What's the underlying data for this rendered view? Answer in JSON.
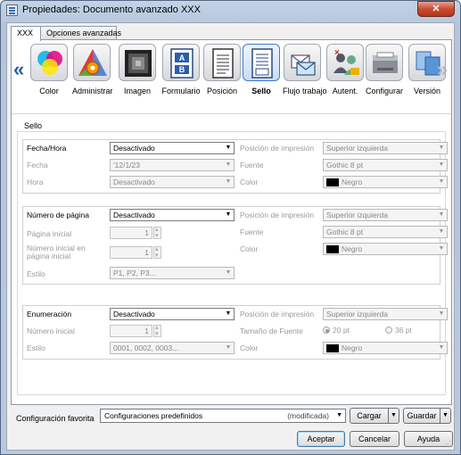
{
  "window": {
    "title": "Propiedades: Documento avanzado XXX",
    "close_glyph": "✕"
  },
  "tabs": [
    {
      "label": "XXX",
      "active": true
    },
    {
      "label": "Opciones avanzadas",
      "active": false
    }
  ],
  "iconbar": {
    "left_arrow": "«",
    "right_arrow": "»",
    "items": [
      {
        "label": "Color",
        "icon": "color-icon"
      },
      {
        "label": "Administrar",
        "icon": "administrar-icon"
      },
      {
        "label": "Imagen",
        "icon": "imagen-icon"
      },
      {
        "label": "Formulario",
        "icon": "formulario-icon"
      },
      {
        "label": "Posición",
        "icon": "posicion-icon"
      },
      {
        "label": "Sello",
        "icon": "sello-icon",
        "selected": true
      },
      {
        "label": "Flujo trabajo",
        "icon": "flujo-trabajo-icon"
      },
      {
        "label": "Autent.",
        "icon": "autent-icon"
      },
      {
        "label": "Configurar",
        "icon": "configurar-icon"
      },
      {
        "label": "Versión",
        "icon": "version-icon"
      }
    ]
  },
  "section_title": "Sello",
  "fecha_group": {
    "main_label": "Fecha/Hora",
    "main_value": "Desactivado",
    "fecha_label": "Fecha",
    "fecha_value": "'12/1/23",
    "hora_label": "Hora",
    "hora_value": "Desactivado",
    "posicion_label": "Posición de impresión",
    "posicion_value": "Superior izquierda",
    "fuente_label": "Fuente",
    "fuente_value": "Gothic 8 pt",
    "color_label": "Color",
    "color_value": "Negro"
  },
  "pagina_group": {
    "main_label": "Número de página",
    "main_value": "Desactivado",
    "inicial_label": "Página inicial",
    "inicial_value": "1",
    "numero_inicial_label": "Número inicial en página inicial",
    "numero_inicial_value": "1",
    "estilo_label": "Estilo",
    "estilo_value": "P1, P2, P3...",
    "posicion_label": "Posición de impresión",
    "posicion_value": "Superior izquierda",
    "fuente_label": "Fuente",
    "fuente_value": "Gothic 8 pt",
    "color_label": "Color",
    "color_value": "Negro"
  },
  "enum_group": {
    "main_label": "Enumeración",
    "main_value": "Desactivado",
    "numero_inicial_label": "Número inicial",
    "numero_inicial_value": "1",
    "estilo_label": "Estilo",
    "estilo_value": "0001, 0002, 0003...",
    "posicion_label": "Posición de impresión",
    "posicion_value": "Superior izquierda",
    "tamano_label": "Tamaño de Fuente",
    "tamano_opt1": "20 pt",
    "tamano_opt2": "36 pt",
    "color_label": "Color",
    "color_value": "Negro"
  },
  "bottom": {
    "fav_label": "Configuración favorita",
    "fav_value": "Configuraciones predefinidos",
    "fav_modified": "(modificada)",
    "cargar": "Cargar",
    "guardar": "Guardar"
  },
  "footer": {
    "aceptar": "Aceptar",
    "cancelar": "Cancelar",
    "ayuda": "Ayuda"
  }
}
